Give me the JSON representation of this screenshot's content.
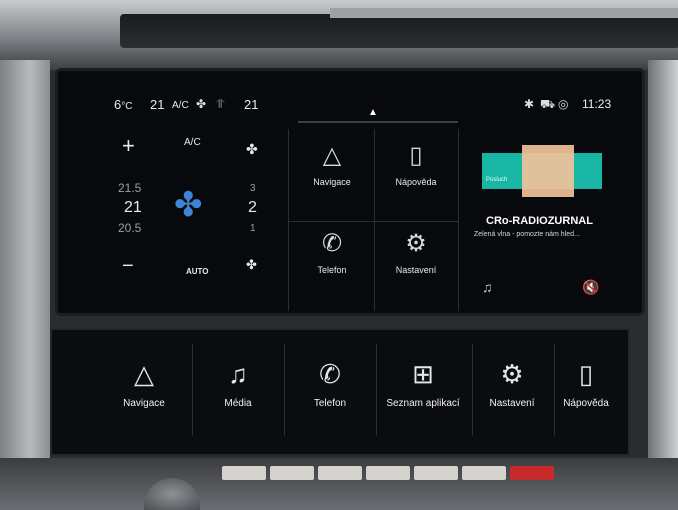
{
  "status_bar": {
    "outside_temp": "6",
    "outside_unit": "°C",
    "set_temp": "21",
    "ac_label": "A/C",
    "fan_icon": "fan-icon",
    "seat_icon": "seat-heat-icon",
    "set_temp_2": "21",
    "home_icon": "home-icon",
    "bluetooth_icon": "bluetooth-icon",
    "car_icon": "car-icon",
    "signal_icon": "signal-icon",
    "time": "11:23"
  },
  "climate": {
    "plus_label": "+",
    "minus_label": "−",
    "ac_label": "A/C",
    "temp_above": "21.5",
    "temp_current": "21",
    "temp_below": "20.5",
    "fan_levels": [
      "3",
      "2",
      "1"
    ],
    "auto_label": "AUTO"
  },
  "tiles": [
    {
      "label": "Navigace",
      "icon": "navigation-arrow-icon"
    },
    {
      "label": "Nápověda",
      "icon": "help-book-icon"
    },
    {
      "label": "Telefon",
      "icon": "phone-icon"
    },
    {
      "label": "Nastavení",
      "icon": "settings-gear-icon"
    }
  ],
  "radio": {
    "art_text": "Posluch",
    "station": "CRo-RADIOZURNAL",
    "song": "Zelená vlna - pomozte nám hled..."
  },
  "bottom_panel": [
    {
      "label": "Navigace",
      "icon": "navigation-arrow-icon"
    },
    {
      "label": "Média",
      "icon": "music-note-icon"
    },
    {
      "label": "Telefon",
      "icon": "phone-icon"
    },
    {
      "label": "Seznam aplikací",
      "icon": "app-grid-icon"
    },
    {
      "label": "Nastavení",
      "icon": "settings-gear-icon"
    },
    {
      "label": "Nápověda",
      "icon": "help-book-icon"
    }
  ]
}
